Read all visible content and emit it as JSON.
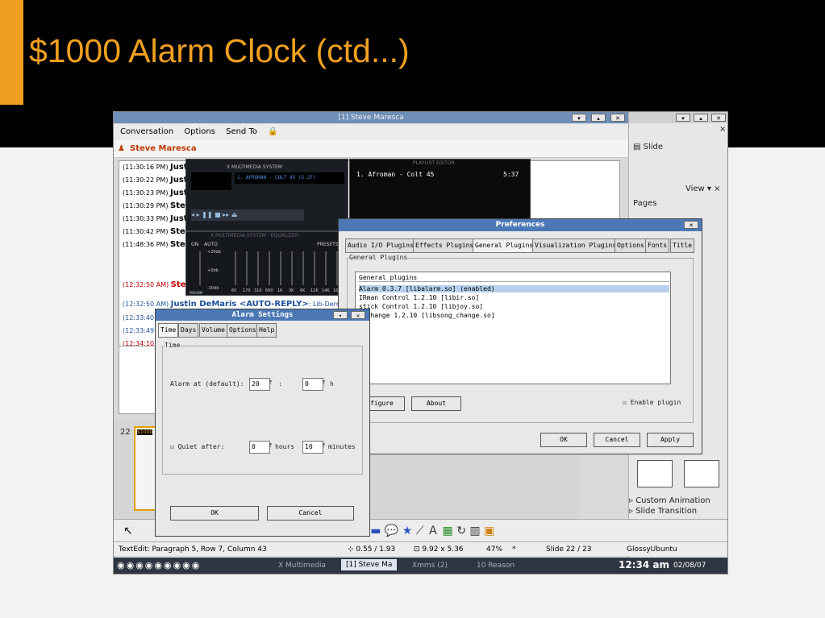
{
  "slide": {
    "title": "$1000 Alarm Clock (ctd...)"
  },
  "im": {
    "window_title": "[1] Steve Maresca",
    "menu": [
      "Conversation",
      "Options",
      "Send To"
    ],
    "buddy": "Steve Maresca",
    "log": [
      {
        "time": "(11:30:16 PM)",
        "name": "Just"
      },
      {
        "time": "(11:30:22 PM)",
        "name": "Just"
      },
      {
        "time": "(11:30:23 PM)",
        "name": "Just"
      },
      {
        "time": "(11:30:29 PM)",
        "name": "Stev"
      },
      {
        "time": "(11:30:33 PM)",
        "name": "Just"
      },
      {
        "time": "(11:30:42 PM)",
        "name": "Stev"
      },
      {
        "time": "(11:48:36 PM)",
        "name": "Stev"
      },
      {
        "time": "(12:32:50 AM)",
        "name": "Stev"
      },
      {
        "time": "(12:32:50 AM)",
        "name": "Justin DeMaris <AUTO-REPLY>",
        "msg": ": Lib-Derry"
      },
      {
        "time": "(12:33:40"
      },
      {
        "time": "(12:33:49"
      },
      {
        "time": "(12:34:10"
      }
    ]
  },
  "right_panel": {
    "slide_label": "Slide",
    "pages_label": "Pages",
    "view_label": "View",
    "custom_animation": "Custom Animation",
    "slide_transition": "Slide Transition"
  },
  "slides_panel": {
    "slide_number": "22",
    "thumb_text": "$1000"
  },
  "statusbar": {
    "text": "TextEdit: Paragraph 5, Row 7, Column 43",
    "position": "0.55 / 1.93",
    "size": "9.92 x 5.36",
    "zoom": "47%",
    "modified": "*",
    "slide_index": "Slide 22 / 23",
    "theme": "GlossyUbuntu"
  },
  "taskbar": {
    "items": [
      "X Multimedia",
      "[1] Steve Ma",
      "Xmms (2)",
      "10 Reason"
    ],
    "clock": "12:34 am",
    "date": "02/08/07"
  },
  "xmms": {
    "main_title": "X MULTIMEDIA SYSTEM",
    "track": "1. AFROMAN - COLT 45 (5:37)",
    "eq_title": "X MULTIMEDIA SYSTEM - EQUALIZER",
    "eq_on": "ON",
    "eq_auto": "AUTO",
    "eq_presets": "PRESETS",
    "eq_plus": "+20db",
    "eq_zero": "+0db",
    "eq_minus": "-20db",
    "eq_preamp": "PREAMP",
    "eq_bands": [
      "60",
      "170",
      "310",
      "600",
      "1K",
      "3K",
      "6K",
      "12K",
      "14K",
      "16K"
    ],
    "playlist_title": "PLAYLIST EDITOR",
    "playlist_item": "1. Afroman - Colt 45",
    "playlist_time": "5:37"
  },
  "prefs": {
    "title": "Preferences",
    "tabs": [
      "Audio I/O Plugins",
      "Effects Plugins",
      "General Plugins",
      "Visualization Plugins",
      "Options",
      "Fonts",
      "Title"
    ],
    "group_label": "General Plugins",
    "list_header": "General plugins",
    "plugins": [
      "Alarm 0.3.7   [libalarm.so] (enabled)",
      "IRman Control 1.2.10   [libir.so]",
      "stick Control 1.2.10   [libjoy.so]",
      "g Change 1.2.10   [libsong_change.so]"
    ],
    "configure": "nfigure",
    "about": "About",
    "enable_plugin": "Enable plugin",
    "ok": "OK",
    "cancel": "Cancel",
    "apply": "Apply"
  },
  "alarm": {
    "title": "Alarm Settings",
    "tabs": [
      "Time",
      "Days",
      "Volume",
      "Options",
      "Help"
    ],
    "group_label": "Time",
    "alarm_label": "Alarm at (default):",
    "alarm_hour": "20",
    "colon": ":",
    "alarm_min": "0",
    "h_label": "h",
    "quiet_label": "Quiet after:",
    "quiet_hours": "0",
    "hours_label": "hours",
    "quiet_minutes": "10",
    "minutes_label": "minutes",
    "ok": "OK",
    "cancel": "Cancel"
  }
}
